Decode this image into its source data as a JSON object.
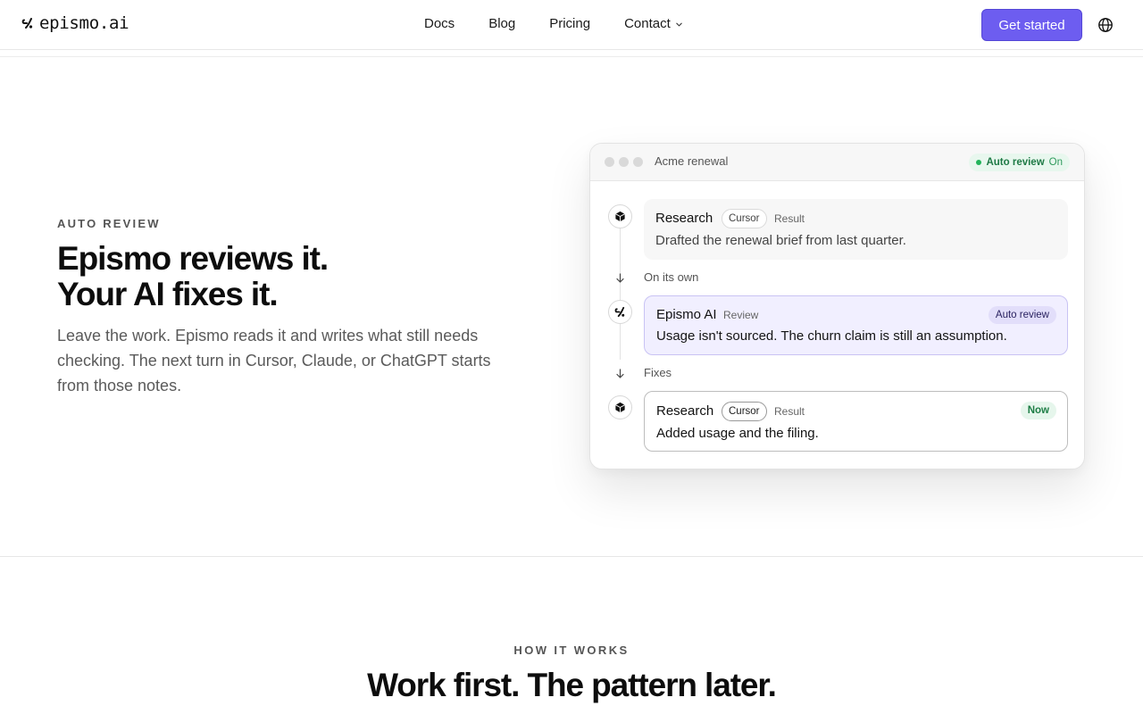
{
  "nav": {
    "logo_text": "epismo.ai",
    "links": [
      "Docs",
      "Blog",
      "Pricing"
    ],
    "contact_label": "Contact",
    "cta_label": "Get started"
  },
  "hero": {
    "eyebrow": "AUTO REVIEW",
    "title_line1": "Epismo reviews it.",
    "title_line2": "Your AI fixes it.",
    "subtitle": "Leave the work. Epismo reads it and writes what still needs checking. The next turn in Cursor, Claude, or ChatGPT starts from those notes."
  },
  "card": {
    "title": "Acme renewal",
    "auto_review_label": "Auto review",
    "auto_review_state": "On",
    "entries": [
      {
        "name": "Research",
        "tag": "Cursor",
        "meta": "Result",
        "text": "Drafted the renewal brief from last quarter."
      },
      {
        "name": "Epismo AI",
        "meta": "Review",
        "badge": "Auto review",
        "text": "Usage isn't sourced. The churn claim is still an assumption."
      },
      {
        "name": "Research",
        "tag": "Cursor",
        "meta": "Result",
        "badge": "Now",
        "text": "Added usage and the filing."
      }
    ],
    "steps": [
      "On its own",
      "Fixes"
    ]
  },
  "how": {
    "eyebrow": "HOW IT WORKS",
    "title": "Work first. The pattern later."
  },
  "colors": {
    "accent": "#6d5df0",
    "review_bg": "#f1efff",
    "status_green": "#22b45a"
  }
}
